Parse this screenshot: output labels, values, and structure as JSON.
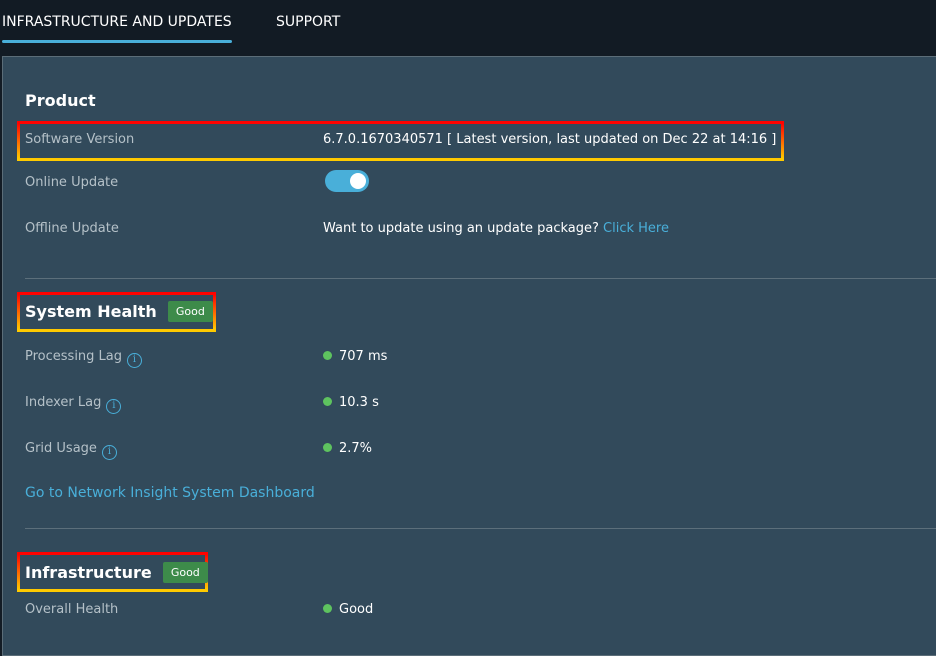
{
  "tabs": [
    {
      "label": "INFRASTRUCTURE AND UPDATES",
      "active": true
    },
    {
      "label": "SUPPORT",
      "active": false
    }
  ],
  "product": {
    "title": "Product",
    "software_version_label": "Software Version",
    "software_version_value": "6.7.0.1670340571 [ Latest version, last updated on Dec 22 at 14:16 ]",
    "online_update_label": "Online Update",
    "online_update_enabled": true,
    "offline_update_label": "Offline Update",
    "offline_update_text": "Want to update using an update package?",
    "offline_update_link": "Click Here"
  },
  "system_health": {
    "title": "System Health",
    "status": "Good",
    "metrics": [
      {
        "label": "Processing Lag",
        "value": "707 ms"
      },
      {
        "label": "Indexer Lag",
        "value": "10.3 s"
      },
      {
        "label": "Grid Usage",
        "value": "2.7%"
      }
    ],
    "info_glyph": "i",
    "dashboard_link": "Go to Network Insight System Dashboard"
  },
  "infrastructure": {
    "title": "Infrastructure",
    "status": "Good",
    "overall_label": "Overall Health",
    "overall_value": "Good"
  },
  "colors": {
    "accent": "#49afd9",
    "good": "#3d8b4a",
    "dot": "#5ec35f"
  }
}
